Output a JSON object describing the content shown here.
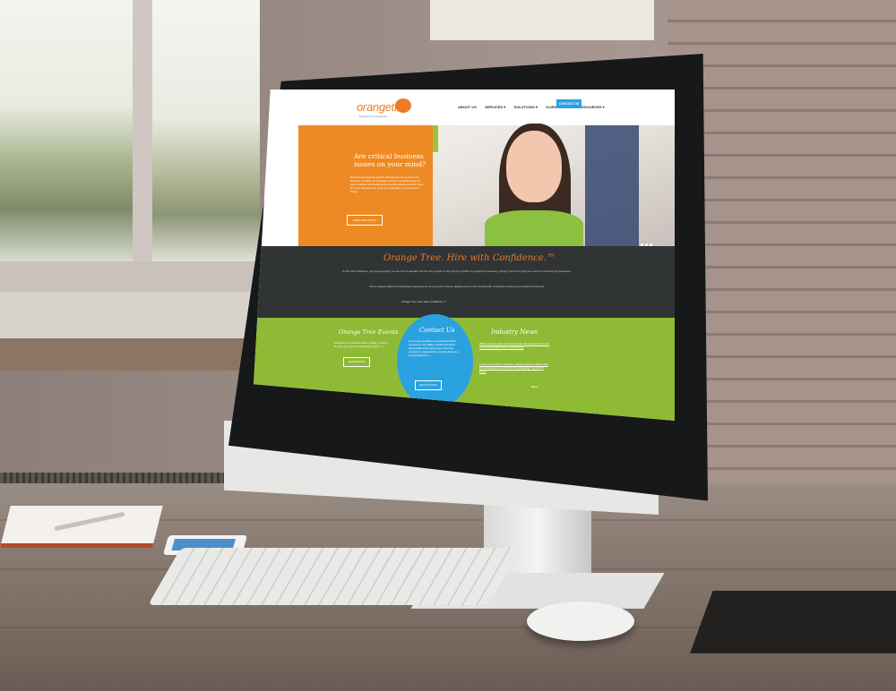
{
  "site": {
    "logo_text": "orangetree",
    "logo_tagline": "Employment Screening",
    "nav": [
      "ABOUT US",
      "SERVICES ▾",
      "SOLUTIONS ▾",
      "CLIENT LOGIN",
      "RESOURCES ▾"
    ],
    "contact_button": "CONTACT US",
    "hero": {
      "heading": "Are critical business issues on your mind?",
      "body": "Discover how working together Orange Tree can support your business of realize, as a strategic resource we will leverage our team expertise and background screening practices to drive value and help address some of the top challenges your business is facing.",
      "button": "VIEW SOLUTIONS"
    },
    "confidence": {
      "heading": "Orange Tree. Hire with Confidence.™",
      "p1": "To hire with confidence, you need a partner you can trust to alleviate risk from the process. As the premier provider of employment screening, Orange Tree turns hiring into a source of security and assurance.",
      "p2": "We're uniquely skilled at extraordinary experience to set you up for success, allowing you to move forward with confidence knowing you're backed by the best.",
      "signature": "Orange Tree. Hire with Confidence.™"
    },
    "events": {
      "heading": "Orange Tree Events",
      "body": "Orange Tree is proud to offer a variety of events for keep you informed on industry topics. [...]",
      "button": "LEARN MORE"
    },
    "contact": {
      "heading": "Contact Us",
      "body": "It's our goal to deliver an exceptional client experience. Our ability to build successful partnerships and employment screening programs is supported by ensuring there is a strong business [...]",
      "button": "GET IN TOUCH"
    },
    "news": {
      "heading": "Industry News",
      "item1": "PBS's economy jobs short, and/or store Background checks for those working with minors found lacking",
      "item2": "Fourth Circuit Affirms Summary Judgment Against EEOC after Excluding Expert Report With \"Mind-Boggling\" Number Of Errors",
      "more": "More"
    }
  },
  "colors": {
    "orange": "#ee8a24",
    "green": "#8fba35",
    "blue": "#2aa2e0",
    "charcoal": "#303435"
  }
}
